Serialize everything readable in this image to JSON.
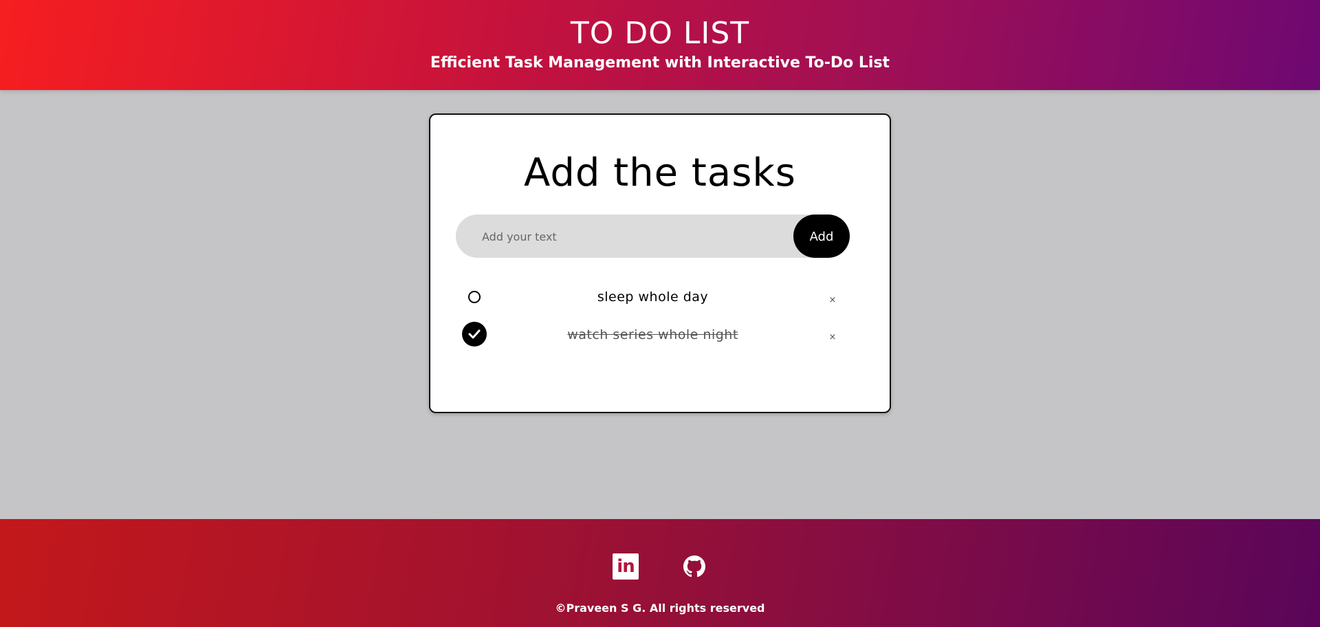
{
  "header": {
    "title": "TO DO LIST",
    "subtitle": "Efficient Task Management with Interactive To-Do List"
  },
  "card": {
    "title": "Add the tasks",
    "input": {
      "placeholder": "Add your text",
      "value": ""
    },
    "add_label": "Add",
    "tasks": [
      {
        "text": "sleep whole day",
        "completed": false,
        "delete_label": "×"
      },
      {
        "text": "watch series whole night",
        "completed": true,
        "delete_label": "×"
      }
    ]
  },
  "footer": {
    "linkedin_label": "in",
    "copyright": "©Praveen S G. All rights reserved",
    "icons": [
      "linkedin-icon",
      "github-icon"
    ]
  },
  "colors": {
    "header_gradient_start": "#f61e20",
    "header_gradient_end": "#6e0872",
    "footer_gradient_start": "#c3181b",
    "footer_gradient_end": "#5a055a",
    "page_background": "#c5c5c7",
    "accent": "#000000"
  }
}
